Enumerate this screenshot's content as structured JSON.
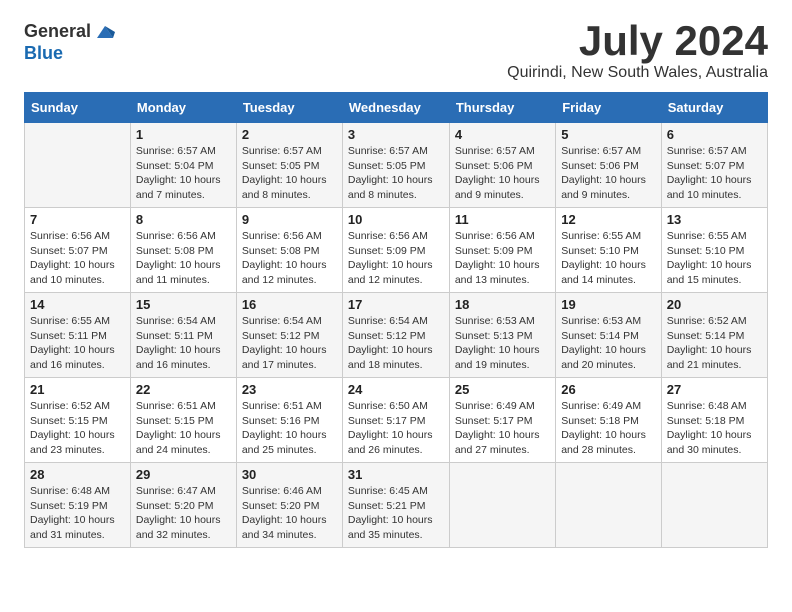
{
  "logo": {
    "general": "General",
    "blue": "Blue"
  },
  "title": "July 2024",
  "location": "Quirindi, New South Wales, Australia",
  "days_of_week": [
    "Sunday",
    "Monday",
    "Tuesday",
    "Wednesday",
    "Thursday",
    "Friday",
    "Saturday"
  ],
  "weeks": [
    [
      {
        "day": "",
        "info": ""
      },
      {
        "day": "1",
        "info": "Sunrise: 6:57 AM\nSunset: 5:04 PM\nDaylight: 10 hours\nand 7 minutes."
      },
      {
        "day": "2",
        "info": "Sunrise: 6:57 AM\nSunset: 5:05 PM\nDaylight: 10 hours\nand 8 minutes."
      },
      {
        "day": "3",
        "info": "Sunrise: 6:57 AM\nSunset: 5:05 PM\nDaylight: 10 hours\nand 8 minutes."
      },
      {
        "day": "4",
        "info": "Sunrise: 6:57 AM\nSunset: 5:06 PM\nDaylight: 10 hours\nand 9 minutes."
      },
      {
        "day": "5",
        "info": "Sunrise: 6:57 AM\nSunset: 5:06 PM\nDaylight: 10 hours\nand 9 minutes."
      },
      {
        "day": "6",
        "info": "Sunrise: 6:57 AM\nSunset: 5:07 PM\nDaylight: 10 hours\nand 10 minutes."
      }
    ],
    [
      {
        "day": "7",
        "info": "Sunrise: 6:56 AM\nSunset: 5:07 PM\nDaylight: 10 hours\nand 10 minutes."
      },
      {
        "day": "8",
        "info": "Sunrise: 6:56 AM\nSunset: 5:08 PM\nDaylight: 10 hours\nand 11 minutes."
      },
      {
        "day": "9",
        "info": "Sunrise: 6:56 AM\nSunset: 5:08 PM\nDaylight: 10 hours\nand 12 minutes."
      },
      {
        "day": "10",
        "info": "Sunrise: 6:56 AM\nSunset: 5:09 PM\nDaylight: 10 hours\nand 12 minutes."
      },
      {
        "day": "11",
        "info": "Sunrise: 6:56 AM\nSunset: 5:09 PM\nDaylight: 10 hours\nand 13 minutes."
      },
      {
        "day": "12",
        "info": "Sunrise: 6:55 AM\nSunset: 5:10 PM\nDaylight: 10 hours\nand 14 minutes."
      },
      {
        "day": "13",
        "info": "Sunrise: 6:55 AM\nSunset: 5:10 PM\nDaylight: 10 hours\nand 15 minutes."
      }
    ],
    [
      {
        "day": "14",
        "info": "Sunrise: 6:55 AM\nSunset: 5:11 PM\nDaylight: 10 hours\nand 16 minutes."
      },
      {
        "day": "15",
        "info": "Sunrise: 6:54 AM\nSunset: 5:11 PM\nDaylight: 10 hours\nand 16 minutes."
      },
      {
        "day": "16",
        "info": "Sunrise: 6:54 AM\nSunset: 5:12 PM\nDaylight: 10 hours\nand 17 minutes."
      },
      {
        "day": "17",
        "info": "Sunrise: 6:54 AM\nSunset: 5:12 PM\nDaylight: 10 hours\nand 18 minutes."
      },
      {
        "day": "18",
        "info": "Sunrise: 6:53 AM\nSunset: 5:13 PM\nDaylight: 10 hours\nand 19 minutes."
      },
      {
        "day": "19",
        "info": "Sunrise: 6:53 AM\nSunset: 5:14 PM\nDaylight: 10 hours\nand 20 minutes."
      },
      {
        "day": "20",
        "info": "Sunrise: 6:52 AM\nSunset: 5:14 PM\nDaylight: 10 hours\nand 21 minutes."
      }
    ],
    [
      {
        "day": "21",
        "info": "Sunrise: 6:52 AM\nSunset: 5:15 PM\nDaylight: 10 hours\nand 23 minutes."
      },
      {
        "day": "22",
        "info": "Sunrise: 6:51 AM\nSunset: 5:15 PM\nDaylight: 10 hours\nand 24 minutes."
      },
      {
        "day": "23",
        "info": "Sunrise: 6:51 AM\nSunset: 5:16 PM\nDaylight: 10 hours\nand 25 minutes."
      },
      {
        "day": "24",
        "info": "Sunrise: 6:50 AM\nSunset: 5:17 PM\nDaylight: 10 hours\nand 26 minutes."
      },
      {
        "day": "25",
        "info": "Sunrise: 6:49 AM\nSunset: 5:17 PM\nDaylight: 10 hours\nand 27 minutes."
      },
      {
        "day": "26",
        "info": "Sunrise: 6:49 AM\nSunset: 5:18 PM\nDaylight: 10 hours\nand 28 minutes."
      },
      {
        "day": "27",
        "info": "Sunrise: 6:48 AM\nSunset: 5:18 PM\nDaylight: 10 hours\nand 30 minutes."
      }
    ],
    [
      {
        "day": "28",
        "info": "Sunrise: 6:48 AM\nSunset: 5:19 PM\nDaylight: 10 hours\nand 31 minutes."
      },
      {
        "day": "29",
        "info": "Sunrise: 6:47 AM\nSunset: 5:20 PM\nDaylight: 10 hours\nand 32 minutes."
      },
      {
        "day": "30",
        "info": "Sunrise: 6:46 AM\nSunset: 5:20 PM\nDaylight: 10 hours\nand 34 minutes."
      },
      {
        "day": "31",
        "info": "Sunrise: 6:45 AM\nSunset: 5:21 PM\nDaylight: 10 hours\nand 35 minutes."
      },
      {
        "day": "",
        "info": ""
      },
      {
        "day": "",
        "info": ""
      },
      {
        "day": "",
        "info": ""
      }
    ]
  ]
}
